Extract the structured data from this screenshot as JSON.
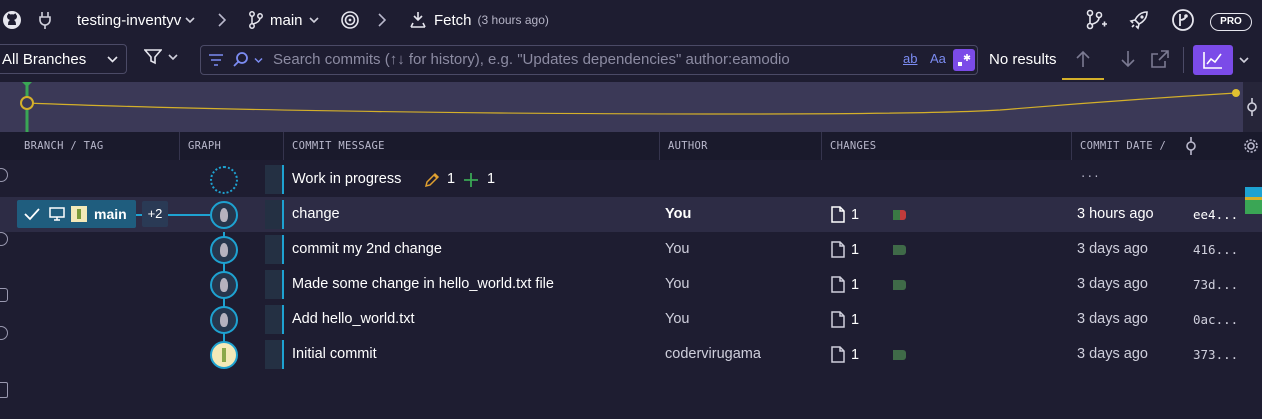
{
  "topbar": {
    "repo": "testing-inventyv",
    "branch": "main",
    "fetch_label": "Fetch",
    "fetch_time": "(3 hours ago)",
    "pro_badge": "PRO"
  },
  "searchbar": {
    "branch_filter": "All Branches",
    "search_placeholder": "Search commits (↑↓ for history), e.g. \"Updates dependencies\" author:eamodio",
    "match_case_label": "Aa",
    "word_label": "ab",
    "results": "No results"
  },
  "columns": {
    "branch_tag": "BRANCH / TAG",
    "graph": "GRAPH",
    "message": "COMMIT MESSAGE",
    "author": "AUTHOR",
    "changes": "CHANGES",
    "date": "COMMIT DATE / ..."
  },
  "branch_label": {
    "name": "main",
    "extra": "+2"
  },
  "wip": {
    "message": "Work in progress",
    "modified": "1",
    "added": "1"
  },
  "commits": [
    {
      "message": "change",
      "author": "You",
      "changes": "1",
      "date": "3 hours ago",
      "sha": "ee4...",
      "bar": [
        "#3a7a44",
        "#c23b3b"
      ]
    },
    {
      "message": "commit my 2nd change",
      "author": "You",
      "changes": "1",
      "date": "3 days ago",
      "sha": "416...",
      "bar": [
        "#3f6a48"
      ]
    },
    {
      "message": "Made some change in hello_world.txt file",
      "author": "You",
      "changes": "1",
      "date": "3 days ago",
      "sha": "73d...",
      "bar": [
        "#3f6a48"
      ]
    },
    {
      "message": "Add hello_world.txt",
      "author": "You",
      "changes": "1",
      "date": "3 days ago",
      "sha": "0ac...",
      "bar": []
    },
    {
      "message": "Initial commit",
      "author": "codervirugama",
      "changes": "1",
      "date": "3 days ago",
      "sha": "373...",
      "bar": [
        "#3f6a48"
      ]
    }
  ],
  "colors": {
    "accent": "#7b4be8",
    "graph_line": "#1ea2d1",
    "minimap_line": "#d4b02a"
  }
}
